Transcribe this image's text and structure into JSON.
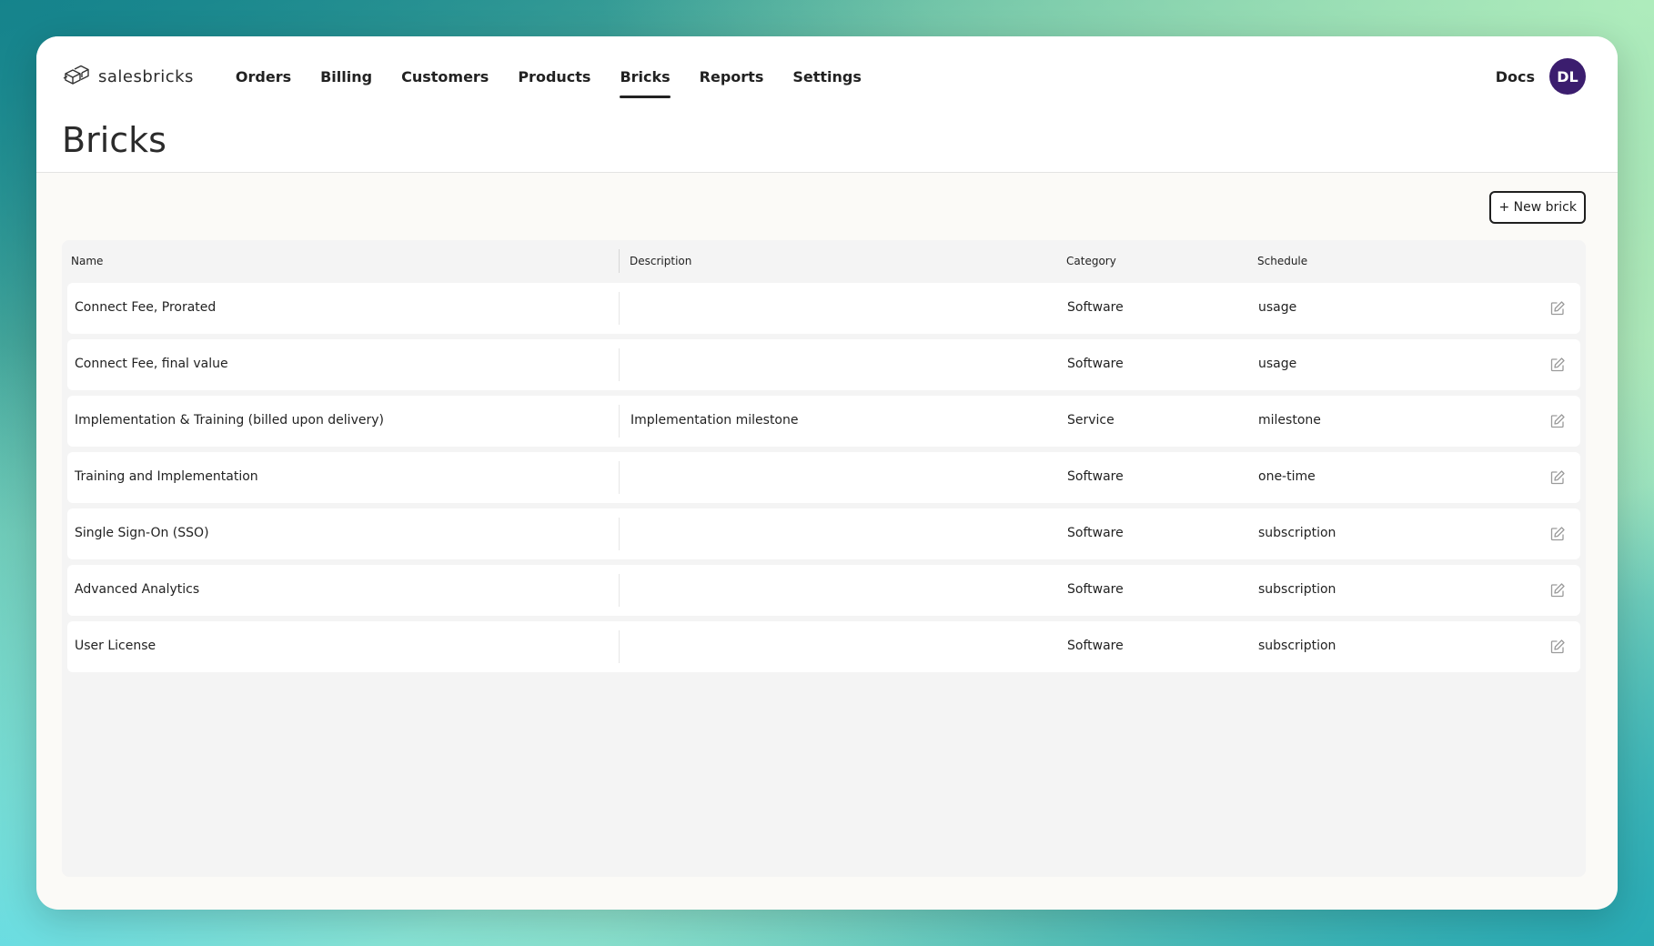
{
  "brand": {
    "name": "salesbricks"
  },
  "nav": {
    "items": [
      {
        "label": "Orders"
      },
      {
        "label": "Billing"
      },
      {
        "label": "Customers"
      },
      {
        "label": "Products"
      },
      {
        "label": "Bricks"
      },
      {
        "label": "Reports"
      },
      {
        "label": "Settings"
      }
    ],
    "active": "Bricks"
  },
  "topbar": {
    "docs_label": "Docs",
    "avatar_initials": "DL",
    "avatar_color": "#3b1d6e"
  },
  "page": {
    "title": "Bricks"
  },
  "toolbar": {
    "new_brick_label": "+ New brick"
  },
  "table": {
    "columns": [
      "Name",
      "Description",
      "Category",
      "Schedule"
    ],
    "rows": [
      {
        "name": "Connect Fee, Prorated",
        "description": "",
        "category": "Software",
        "schedule": "usage"
      },
      {
        "name": "Connect Fee, final value",
        "description": "",
        "category": "Software",
        "schedule": "usage"
      },
      {
        "name": "Implementation & Training (billed upon delivery)",
        "description": "Implementation milestone",
        "category": "Service",
        "schedule": "milestone"
      },
      {
        "name": "Training and Implementation",
        "description": "",
        "category": "Software",
        "schedule": "one-time"
      },
      {
        "name": "Single Sign-On (SSO)",
        "description": "",
        "category": "Software",
        "schedule": "subscription"
      },
      {
        "name": "Advanced Analytics",
        "description": "",
        "category": "Software",
        "schedule": "subscription"
      },
      {
        "name": "User License",
        "description": "",
        "category": "Software",
        "schedule": "subscription"
      }
    ],
    "row_action_icon": "edit-icon"
  }
}
